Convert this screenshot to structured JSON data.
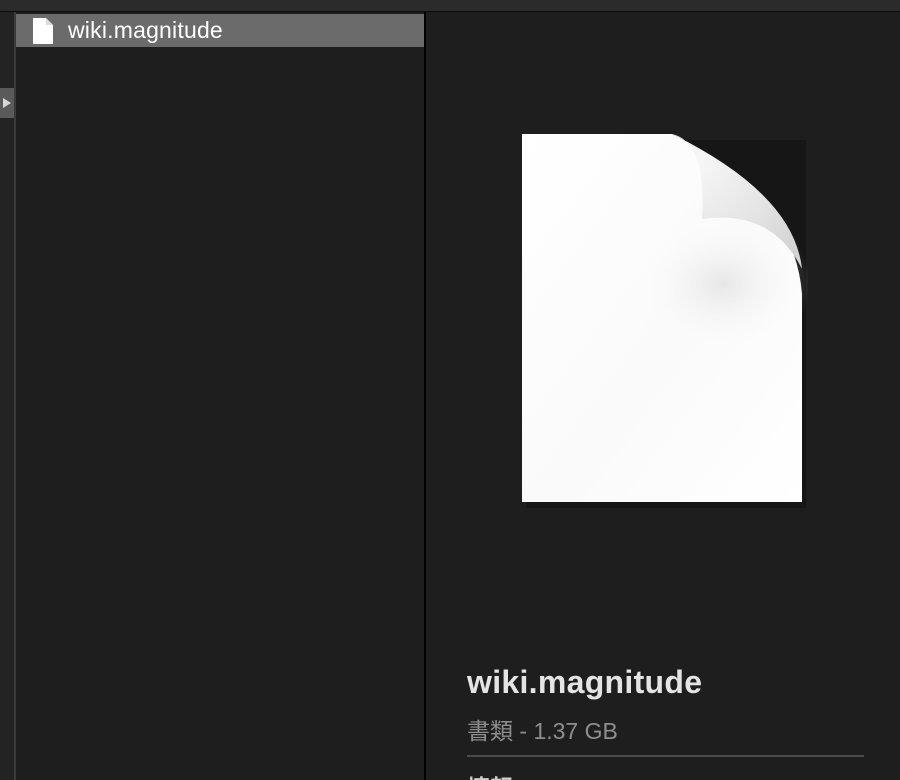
{
  "window": {
    "accent_selection": "#6b6b6b",
    "background": "#1e1e1e"
  },
  "file_list": {
    "items": [
      {
        "label": "wiki.magnitude",
        "icon": "document-icon",
        "selected": true
      }
    ]
  },
  "preview": {
    "icon": "document-icon",
    "file_name": "wiki.magnitude",
    "meta": "書類 - 1.37 GB",
    "section_heading": "情報"
  }
}
